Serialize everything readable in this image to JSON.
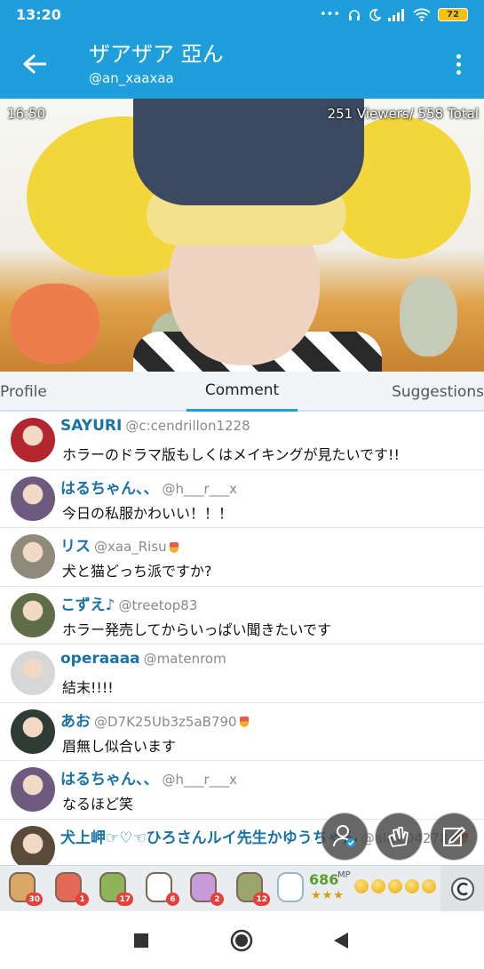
{
  "status_bar": {
    "time": "13:20",
    "battery": "72"
  },
  "header": {
    "title": "ザアザア 亞ん",
    "subtitle": "@an_xaaxaa"
  },
  "video": {
    "time": "16:50",
    "viewers": "251 Viewers/ 558 Total"
  },
  "tabs": [
    {
      "label": "Profile"
    },
    {
      "label": "Comment"
    },
    {
      "label": "Suggestions"
    }
  ],
  "active_tab": "Comment",
  "comments": [
    {
      "name": "SAYURI",
      "handle": "@c:cendrillon1228",
      "text": "ホラーのドラマ版もしくはメイキングが見たいです!!",
      "medal": false,
      "avatar_color": "#b3262d"
    },
    {
      "name": "はるちゃん、、",
      "handle": "@h___r___x",
      "text": "今日の私服かわいい！！！",
      "medal": false,
      "avatar_color": "#6d5a7e"
    },
    {
      "name": "リス",
      "handle": "@xaa_Risu",
      "text": "犬と猫どっち派ですか?",
      "medal": true,
      "avatar_color": "#8f8a7b"
    },
    {
      "name": "こずえ♪",
      "handle": "@treetop83",
      "text": "ホラー発売してからいっぱい聞きたいです",
      "medal": false,
      "avatar_color": "#5f6e48"
    },
    {
      "name": "operaaaa",
      "handle": "@matenrom",
      "text": "結末!!!!",
      "medal": false,
      "avatar_color": "#d7d7d7"
    },
    {
      "name": "あお",
      "handle": "@D7K25Ub3z5aB790",
      "text": "眉無し似合います",
      "medal": true,
      "avatar_color": "#2f3b35"
    },
    {
      "name": "はるちゃん、、",
      "handle": "@h___r___x",
      "text": "なるほど笑",
      "medal": false,
      "avatar_color": "#6d5a7e"
    },
    {
      "name": "犬上岬☞♡☜ひろさんルイ先生かゆうちゃん",
      "handle": "@alice042784",
      "text": "",
      "medal": true,
      "avatar_color": "#5a4a3a"
    }
  ],
  "fabs": [
    {
      "icon": "follow-user-icon"
    },
    {
      "icon": "clap-icon"
    },
    {
      "icon": "compose-icon"
    }
  ],
  "gifts": [
    {
      "count": "30",
      "color": "#d9a766"
    },
    {
      "count": "1",
      "color": "#e46a57"
    },
    {
      "count": "17",
      "color": "#8fb35a"
    },
    {
      "count": "6",
      "color": "#ffffff"
    },
    {
      "count": "2",
      "color": "#c79ad9"
    },
    {
      "count": "12",
      "color": "#9aa56b"
    }
  ],
  "mp": {
    "value": "686",
    "label": "MP",
    "stars": "★★★"
  },
  "accent_color": "#1e9fdb"
}
